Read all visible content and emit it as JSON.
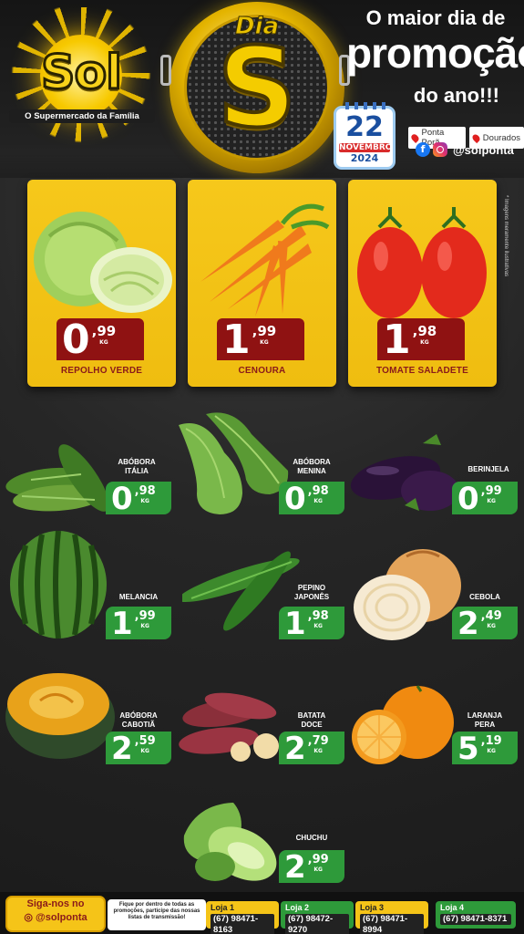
{
  "brand": {
    "name": "Sol",
    "tagline": "O Supermercado da Família"
  },
  "event": {
    "badge_top": "Dia",
    "badge_letter": "S",
    "headline_1": "O maior dia de",
    "headline_2": "promoção",
    "headline_3": "do ano!!!",
    "date_day": "22",
    "date_month": "NOVEMBRO",
    "date_year": "2024"
  },
  "locations": [
    "Ponta Porã",
    "Dourados"
  ],
  "social_handle": "@solponta",
  "disclaimer": "* Imagens meramente ilustrativas",
  "featured": [
    {
      "name": "REPOLHO VERDE",
      "int": "0",
      "cents": ",99",
      "unit": "KG"
    },
    {
      "name": "CENOURA",
      "int": "1",
      "cents": ",99",
      "unit": "KG"
    },
    {
      "name": "TOMATE SALADETE",
      "int": "1",
      "cents": ",98",
      "unit": "KG"
    }
  ],
  "products": [
    {
      "name_1": "ABÓBORA",
      "name_2": "ITÁLIA",
      "int": "0",
      "cents": ",98",
      "unit": "KG"
    },
    {
      "name_1": "ABÓBORA",
      "name_2": "MENINA",
      "int": "0",
      "cents": ",98",
      "unit": "KG"
    },
    {
      "name_1": "BERINJELA",
      "name_2": "",
      "int": "0",
      "cents": ",99",
      "unit": "KG"
    },
    {
      "name_1": "MELANCIA",
      "name_2": "",
      "int": "1",
      "cents": ",99",
      "unit": "KG"
    },
    {
      "name_1": "PEPINO",
      "name_2": "JAPONÊS",
      "int": "1",
      "cents": ",98",
      "unit": "KG"
    },
    {
      "name_1": "CEBOLA",
      "name_2": "",
      "int": "2",
      "cents": ",49",
      "unit": "KG"
    },
    {
      "name_1": "ABÓBORA",
      "name_2": "CABOTIÃ",
      "int": "2",
      "cents": ",59",
      "unit": "KG"
    },
    {
      "name_1": "BATATA",
      "name_2": "DOCE",
      "int": "2",
      "cents": ",79",
      "unit": "KG"
    },
    {
      "name_1": "LARANJA",
      "name_2": "PERA",
      "int": "5",
      "cents": ",19",
      "unit": "KG"
    },
    {
      "name_1": "CHUCHU",
      "name_2": "",
      "int": "2",
      "cents": ",99",
      "unit": "KG"
    }
  ],
  "footer": {
    "follow_label": "Siga-nos no",
    "follow_handle": "@solponta",
    "stream_text": "Fique por dentro de todas as promoções, participe das nossas listas de transmissão!",
    "stores": [
      {
        "label": "Loja 1",
        "phone": "(67) 98471-8163",
        "color": "#f5c418"
      },
      {
        "label": "Loja 2",
        "phone": "(67) 98472-9270",
        "color": "#2e9a3a"
      },
      {
        "label": "Loja 3",
        "phone": "(67) 98471-8994",
        "color": "#f5c418"
      },
      {
        "label": "Loja 4",
        "phone": "(67) 98471-8371",
        "color": "#2e9a3a"
      }
    ]
  },
  "colors": {
    "yellow": "#f5c418",
    "green": "#2e9a3a",
    "maroon": "#8f1212"
  }
}
